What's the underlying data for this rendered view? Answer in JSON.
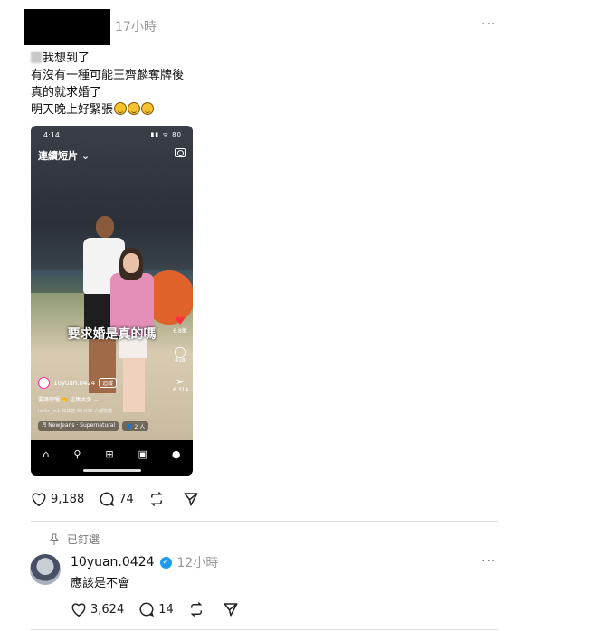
{
  "post": {
    "timestamp": "17小時",
    "more_label": "···",
    "lines": [
      "我想到了",
      "有沒有一種可能王齊麟奪牌後",
      "真的就求婚了",
      "明天晚上好緊張"
    ],
    "likes": "9,188",
    "comments": "74"
  },
  "video": {
    "status_time": "4:14",
    "status_icons": "▮▮ ᯤ 80",
    "tab_title": "連續短片 ⌄",
    "caption": "要求婚是真的嗎",
    "side_counts": {
      "likes": "6.8萬",
      "comments": "418",
      "shares": "6,314"
    },
    "account": "10yuan.0424",
    "follow_label": "追蹤",
    "desc": "要謙辦喔 👏 這集太美 …",
    "liked_by": "hello_nick 和其他 68,635 人都按讚",
    "music": "♬ NewJeans · Supernatural",
    "people": "👤 2 人"
  },
  "pinned": {
    "label": "已釘選"
  },
  "reply": {
    "username": "10yuan.0424",
    "timestamp": "12小時",
    "text": "應該是不會",
    "likes": "3,624",
    "comments": "14",
    "more_label": "···"
  }
}
